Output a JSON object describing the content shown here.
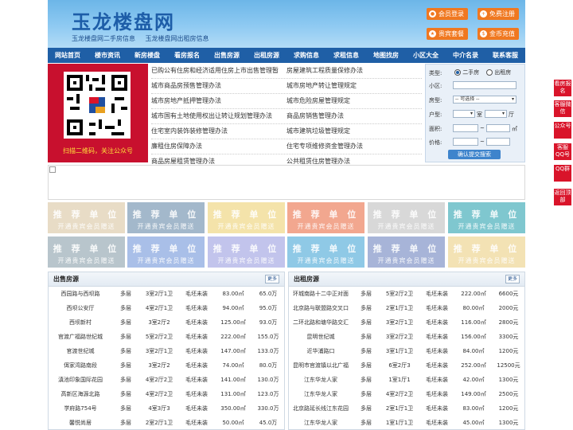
{
  "site": {
    "logo": "玉龙楼盘网",
    "sublinks": [
      "玉龙楼盘网二手房信息",
      "玉龙楼盘网出租房信息"
    ],
    "buttons": [
      {
        "label": "会员登录",
        "icon": "user-icon"
      },
      {
        "label": "免费注册",
        "icon": "register-icon"
      },
      {
        "label": "贵宾套餐",
        "icon": "vip-icon"
      },
      {
        "label": "金币充值",
        "icon": "coin-icon"
      }
    ]
  },
  "nav": [
    "网站首页",
    "楼市资讯",
    "新房楼盘",
    "看房报名",
    "出售房源",
    "出租房源",
    "求购信息",
    "求租信息",
    "地图找房",
    "小区大全",
    "中介名录",
    "联系客服"
  ],
  "qr": {
    "caption": "扫描二维码，关注公众号"
  },
  "notices": [
    [
      "已购公有住房和经济适用住房上市出售管理暂",
      "房屋建筑工程质量保修办法"
    ],
    [
      "城市商品房预售管理办法",
      "城市房地产转让管理规定"
    ],
    [
      "城市房地产抵押管理办法",
      "城市危险房屋管理规定"
    ],
    [
      "城市国有土地使用权出让转让规划管理办法",
      "商品房销售管理办法"
    ],
    [
      "住宅室内装饰装修管理办法",
      "城市建筑垃圾管理规定"
    ],
    [
      "廉租住房保障办法",
      "住宅专项维修资金管理办法"
    ],
    [
      "商品房屋租赁管理办法",
      "公共租赁住房管理办法"
    ]
  ],
  "search": {
    "type_label": "类型:",
    "opt1": "二手房",
    "opt2": "出租房",
    "xiaoqu_label": "小区:",
    "fangxing_label": "房型:",
    "fangxing_value": "-- 可选择 --",
    "huxing_label": "户型:",
    "shi": "室",
    "ting": "厅",
    "area_label": "面积:",
    "area_unit": "㎡",
    "price_label": "价格:",
    "tilde": "~",
    "submit": "确认提交搜索"
  },
  "recommend": {
    "line1": "推 荐 单 位",
    "line2": "开通贵宾会员赠送",
    "colors": [
      "#e8dcc6",
      "#a3b8cb",
      "#f4e3aa",
      "#f2a78f",
      "#d8d8d8",
      "#7fc7cf",
      "#b8c5cc",
      "#a9bfe8",
      "#c2c4ec",
      "#8fc9e6",
      "#a7b4d8",
      "#f3e2b4"
    ]
  },
  "sale": {
    "title": "出售房源",
    "more": "更多",
    "rows": [
      [
        "西园路与西坝路",
        "多层",
        "3室2厅1卫",
        "毛坯未装",
        "83.00㎡",
        "65.0万"
      ],
      [
        "西坝公安厅",
        "多层",
        "4室2厅1卫",
        "毛坯未装",
        "94.00㎡",
        "95.0万"
      ],
      [
        "西坝新村",
        "多层",
        "3室2厅2",
        "毛坯未装",
        "125.00㎡",
        "93.0万"
      ],
      [
        "官渡广福路世纪城",
        "多层",
        "5室2厅2卫",
        "毛坯未装",
        "222.00㎡",
        "155.0万"
      ],
      [
        "官渡世纪城",
        "多层",
        "3室2厅1卫",
        "毛坯未装",
        "147.00㎡",
        "133.0万"
      ],
      [
        "佴家湾路南段",
        "多层",
        "3室2厅2",
        "毛坯未装",
        "74.00㎡",
        "80.0万"
      ],
      [
        "滇池印象国际花园",
        "多层",
        "4室2厅2卫",
        "毛坯未装",
        "141.00㎡",
        "130.0万"
      ],
      [
        "高新区海源北路",
        "多层",
        "4室2厅2卫",
        "毛坯未装",
        "131.00㎡",
        "123.0万"
      ],
      [
        "学府路754号",
        "多层",
        "4室3厅3",
        "毛坯未装",
        "350.00㎡",
        "330.0万"
      ],
      [
        "馨悦尚居",
        "多层",
        "2室2厅1卫",
        "毛坯未装",
        "50.00㎡",
        "45.0万"
      ]
    ]
  },
  "rent": {
    "title": "出租房源",
    "more": "更多",
    "rows": [
      [
        "环城南路十二中正对面",
        "多层",
        "5室2厅2卫",
        "毛坯未装",
        "222.00㎡",
        "6600元"
      ],
      [
        "北京路与联盟路交叉口",
        "多层",
        "2室1厅1卫",
        "毛坯未装",
        "80.00㎡",
        "2000元"
      ],
      [
        "二环北路和塘华路交汇",
        "多层",
        "3室2厅1卫",
        "毛坯未装",
        "116.00㎡",
        "2800元"
      ],
      [
        "昆明世纪城",
        "多层",
        "3室2厅2卫",
        "毛坯未装",
        "156.00㎡",
        "3300元"
      ],
      [
        "近华浦路口",
        "多层",
        "3室1厅1卫",
        "毛坯未装",
        "84.00㎡",
        "1200元"
      ],
      [
        "昆明市官渡镇以北广福",
        "多层",
        "6室2厅3",
        "毛坯未装",
        "252.00㎡",
        "12500元"
      ],
      [
        "江东华龙人家",
        "多层",
        "1室1厅1",
        "毛坯未装",
        "42.00㎡",
        "1300元"
      ],
      [
        "江东华龙人家",
        "多层",
        "4室2厅2卫",
        "毛坯未装",
        "149.00㎡",
        "2500元"
      ],
      [
        "北京路延长线江东花园",
        "多层",
        "2室1厅1卫",
        "毛坯未装",
        "83.00㎡",
        "1200元"
      ],
      [
        "江东华龙人家",
        "多层",
        "1室1厅1卫",
        "毛坯未装",
        "45.00㎡",
        "1300元"
      ]
    ]
  },
  "float_bar": [
    "看房报名",
    "客服微信",
    "公众号",
    "客服QQ号",
    "QQ群",
    "返回顶部"
  ]
}
